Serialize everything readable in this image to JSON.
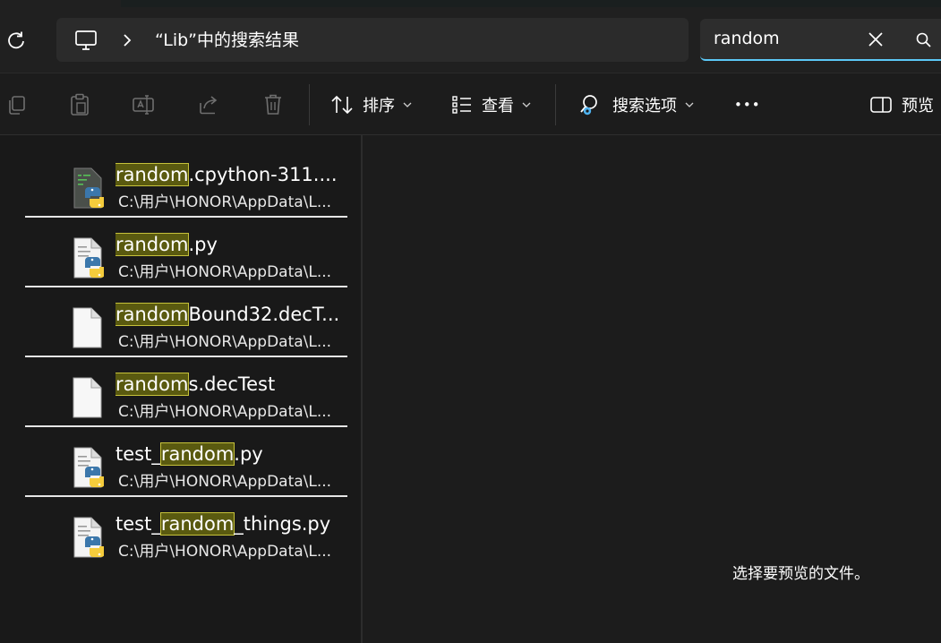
{
  "address": {
    "path_text": "“Lib”中的搜索结果"
  },
  "search": {
    "value": "random"
  },
  "toolbar": {
    "sort_label": "排序",
    "view_label": "查看",
    "search_options_label": "搜索选项",
    "more_label": "•••",
    "preview_label": "预览"
  },
  "results": [
    {
      "hl": "random",
      "name_rest": ".cpython-311....",
      "path": "C:\\用户\\HONOR\\AppData\\L...",
      "icon": "python-compiled-icon"
    },
    {
      "hl": "random",
      "name_rest": ".py",
      "path": "C:\\用户\\HONOR\\AppData\\L...",
      "icon": "python-file-icon"
    },
    {
      "hl": "random",
      "name_rest": "Bound32.decT...",
      "path": "C:\\用户\\HONOR\\AppData\\L...",
      "icon": "blank-file-icon"
    },
    {
      "hl": "random",
      "name_rest": "s.decTest",
      "path": "C:\\用户\\HONOR\\AppData\\L...",
      "icon": "blank-file-icon"
    },
    {
      "pre": "test_",
      "hl": "random",
      "name_rest": ".py",
      "path": "C:\\用户\\HONOR\\AppData\\L...",
      "icon": "python-file-icon"
    },
    {
      "pre": "test_",
      "hl": "random",
      "name_rest": "_things.py",
      "path": "C:\\用户\\HONOR\\AppData\\L...",
      "icon": "python-file-icon"
    }
  ],
  "preview": {
    "empty_message": "选择要预览的文件。"
  },
  "colors": {
    "accent": "#5cc8f6",
    "highlight_bg": "#5a5a10",
    "highlight_border": "#c6c23a"
  }
}
